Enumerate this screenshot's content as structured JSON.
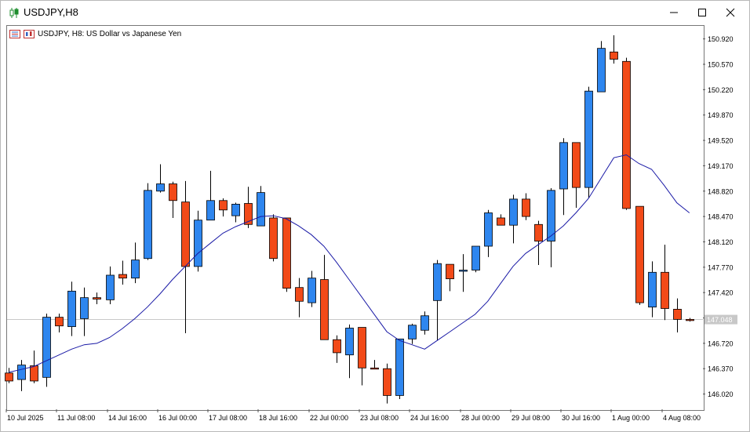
{
  "window": {
    "title": "USDJPY,H8",
    "header_text": "USDJPY, H8:  US Dollar vs Japanese Yen"
  },
  "colors": {
    "bull": "#2e86ef",
    "bear": "#f24a18",
    "ma": "#1a1aa6",
    "wick": "#000000",
    "price_line": "#c8c8c8",
    "price_label_bg": "#c8c8c8"
  },
  "chart_data": {
    "type": "candlestick",
    "symbol": "USDJPY",
    "timeframe": "H8",
    "ylim": [
      145.81,
      151.1
    ],
    "y_ticks": [
      150.92,
      150.57,
      150.22,
      149.87,
      149.52,
      149.17,
      148.82,
      148.47,
      148.12,
      147.77,
      147.42,
      147.07,
      146.72,
      146.37,
      146.02
    ],
    "y_tick_labels": [
      "150.920",
      "150.570",
      "150.220",
      "149.870",
      "149.520",
      "149.170",
      "148.820",
      "148.470",
      "148.120",
      "147.770",
      "147.420",
      "147.070",
      "146.720",
      "146.370",
      "146.020"
    ],
    "current_price": 147.048,
    "current_price_label": "147.048",
    "x_labels": [
      {
        "label": "10 Jul 2025",
        "index": 0
      },
      {
        "label": "11 Jul 08:00",
        "index": 4
      },
      {
        "label": "14 Jul 16:00",
        "index": 8
      },
      {
        "label": "16 Jul 00:00",
        "index": 12
      },
      {
        "label": "17 Jul 08:00",
        "index": 16
      },
      {
        "label": "18 Jul 16:00",
        "index": 20
      },
      {
        "label": "22 Jul 00:00",
        "index": 24
      },
      {
        "label": "23 Jul 08:00",
        "index": 28
      },
      {
        "label": "24 Jul 16:00",
        "index": 32
      },
      {
        "label": "28 Jul 00:00",
        "index": 36
      },
      {
        "label": "29 Jul 08:00",
        "index": 40
      },
      {
        "label": "30 Jul 16:00",
        "index": 44
      },
      {
        "label": "1 Aug 00:00",
        "index": 48
      },
      {
        "label": "4 Aug 08:00",
        "index": 52
      }
    ],
    "candles": [
      {
        "o": 146.31,
        "h": 146.38,
        "l": 146.17,
        "c": 146.2
      },
      {
        "o": 146.22,
        "h": 146.49,
        "l": 146.06,
        "c": 146.42
      },
      {
        "o": 146.41,
        "h": 146.62,
        "l": 146.17,
        "c": 146.2
      },
      {
        "o": 146.25,
        "h": 147.13,
        "l": 146.12,
        "c": 147.08
      },
      {
        "o": 147.08,
        "h": 147.13,
        "l": 146.87,
        "c": 146.96
      },
      {
        "o": 146.95,
        "h": 147.57,
        "l": 146.82,
        "c": 147.44
      },
      {
        "o": 147.06,
        "h": 147.49,
        "l": 146.82,
        "c": 147.35
      },
      {
        "o": 147.35,
        "h": 147.42,
        "l": 147.26,
        "c": 147.33
      },
      {
        "o": 147.32,
        "h": 147.78,
        "l": 147.26,
        "c": 147.66
      },
      {
        "o": 147.67,
        "h": 147.86,
        "l": 147.53,
        "c": 147.62
      },
      {
        "o": 147.62,
        "h": 148.11,
        "l": 147.55,
        "c": 147.87
      },
      {
        "o": 147.89,
        "h": 148.93,
        "l": 147.87,
        "c": 148.83
      },
      {
        "o": 148.82,
        "h": 149.19,
        "l": 148.8,
        "c": 148.92
      },
      {
        "o": 148.92,
        "h": 148.95,
        "l": 148.45,
        "c": 148.69
      },
      {
        "o": 148.67,
        "h": 148.96,
        "l": 146.86,
        "c": 147.78
      },
      {
        "o": 147.78,
        "h": 148.55,
        "l": 147.71,
        "c": 148.42
      },
      {
        "o": 148.42,
        "h": 149.1,
        "l": 148.42,
        "c": 148.69
      },
      {
        "o": 148.69,
        "h": 148.72,
        "l": 148.47,
        "c": 148.56
      },
      {
        "o": 148.48,
        "h": 148.66,
        "l": 148.39,
        "c": 148.64
      },
      {
        "o": 148.65,
        "h": 148.88,
        "l": 148.31,
        "c": 148.36
      },
      {
        "o": 148.34,
        "h": 148.89,
        "l": 148.34,
        "c": 148.8
      },
      {
        "o": 148.45,
        "h": 148.5,
        "l": 147.85,
        "c": 147.89
      },
      {
        "o": 148.45,
        "h": 148.45,
        "l": 147.43,
        "c": 147.48
      },
      {
        "o": 147.49,
        "h": 147.62,
        "l": 147.08,
        "c": 147.3
      },
      {
        "o": 147.28,
        "h": 147.72,
        "l": 147.22,
        "c": 147.62
      },
      {
        "o": 147.6,
        "h": 147.94,
        "l": 146.77,
        "c": 146.77
      },
      {
        "o": 146.77,
        "h": 146.83,
        "l": 146.45,
        "c": 146.59
      },
      {
        "o": 146.56,
        "h": 146.98,
        "l": 146.24,
        "c": 146.93
      },
      {
        "o": 146.94,
        "h": 146.94,
        "l": 146.14,
        "c": 146.38
      },
      {
        "o": 146.38,
        "h": 146.49,
        "l": 146.38,
        "c": 146.37
      },
      {
        "o": 146.37,
        "h": 146.44,
        "l": 145.89,
        "c": 146.0
      },
      {
        "o": 146.0,
        "h": 146.78,
        "l": 145.95,
        "c": 146.78
      },
      {
        "o": 146.78,
        "h": 146.99,
        "l": 146.71,
        "c": 146.97
      },
      {
        "o": 146.9,
        "h": 147.16,
        "l": 146.84,
        "c": 147.1
      },
      {
        "o": 147.31,
        "h": 147.87,
        "l": 146.76,
        "c": 147.82
      },
      {
        "o": 147.81,
        "h": 147.81,
        "l": 147.44,
        "c": 147.61
      },
      {
        "o": 147.72,
        "h": 147.95,
        "l": 147.43,
        "c": 147.73
      },
      {
        "o": 147.73,
        "h": 148.06,
        "l": 147.7,
        "c": 148.06
      },
      {
        "o": 148.06,
        "h": 148.56,
        "l": 147.91,
        "c": 148.52
      },
      {
        "o": 148.45,
        "h": 148.5,
        "l": 148.35,
        "c": 148.35
      },
      {
        "o": 148.35,
        "h": 148.77,
        "l": 148.1,
        "c": 148.71
      },
      {
        "o": 148.71,
        "h": 148.79,
        "l": 148.42,
        "c": 148.47
      },
      {
        "o": 148.36,
        "h": 148.41,
        "l": 147.8,
        "c": 148.13
      },
      {
        "o": 148.13,
        "h": 148.86,
        "l": 147.77,
        "c": 148.83
      },
      {
        "o": 148.85,
        "h": 149.55,
        "l": 148.49,
        "c": 149.49
      },
      {
        "o": 149.49,
        "h": 149.49,
        "l": 148.59,
        "c": 148.87
      },
      {
        "o": 148.87,
        "h": 150.26,
        "l": 148.72,
        "c": 150.2
      },
      {
        "o": 150.19,
        "h": 150.89,
        "l": 150.19,
        "c": 150.79
      },
      {
        "o": 150.74,
        "h": 150.97,
        "l": 150.58,
        "c": 150.64
      },
      {
        "o": 150.61,
        "h": 150.66,
        "l": 148.56,
        "c": 148.58
      },
      {
        "o": 148.61,
        "h": 148.61,
        "l": 147.25,
        "c": 147.28
      },
      {
        "o": 147.22,
        "h": 147.85,
        "l": 147.08,
        "c": 147.7
      },
      {
        "o": 147.7,
        "h": 148.08,
        "l": 147.04,
        "c": 147.2
      },
      {
        "o": 147.19,
        "h": 147.34,
        "l": 146.87,
        "c": 147.05
      },
      {
        "o": 147.05,
        "h": 147.07,
        "l": 147.02,
        "c": 147.04
      }
    ],
    "ma": [
      146.32,
      146.36,
      146.4,
      146.48,
      146.56,
      146.64,
      146.7,
      146.72,
      146.8,
      146.92,
      147.06,
      147.22,
      147.4,
      147.6,
      147.78,
      147.96,
      148.1,
      148.24,
      148.33,
      148.4,
      148.47,
      148.48,
      148.44,
      148.34,
      148.22,
      148.06,
      147.84,
      147.6,
      147.36,
      147.12,
      146.88,
      146.76,
      146.7,
      146.64,
      146.76,
      146.88,
      147.0,
      147.12,
      147.3,
      147.54,
      147.78,
      147.96,
      148.08,
      148.2,
      148.34,
      148.52,
      148.72,
      149.0,
      149.28,
      149.32,
      149.2,
      149.12,
      148.9,
      148.66,
      148.52
    ]
  }
}
